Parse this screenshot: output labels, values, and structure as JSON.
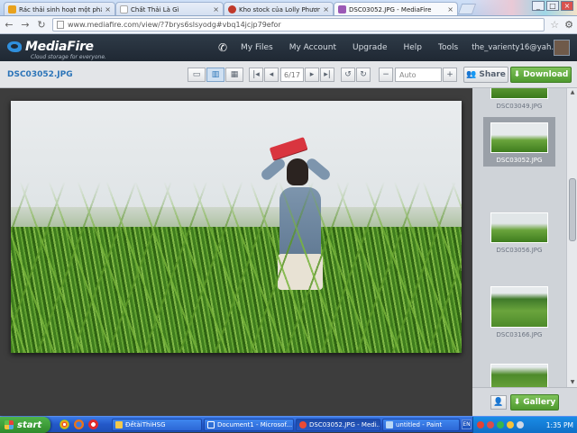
{
  "browser": {
    "tabs": [
      {
        "label": "Rác thải sinh hoạt một phần",
        "fav_color": "#e8a21e",
        "active": false
      },
      {
        "label": "Chất Thải Là Gì",
        "fav_color": "#ffffff",
        "active": false
      },
      {
        "label": "Kho stock của Lolly Phương",
        "fav_color": "#c0392b",
        "active": false
      },
      {
        "label": "DSC03052.JPG - MediaFire",
        "fav_color": "#9b59b6",
        "active": true
      }
    ],
    "url": "www.mediafire.com/view/?7brys6slsyodg#vbq14jcjp79efor",
    "close_glyph": "×"
  },
  "mediafire": {
    "brand": "MediaFire",
    "tagline": "Cloud storage for everyone.",
    "nav": [
      "My Files",
      "My Account",
      "Upgrade",
      "Help",
      "Tools"
    ],
    "user": "the_varienty16@yah..."
  },
  "viewer": {
    "filename": "DSC03052.JPG",
    "page_indicator": "6/17",
    "zoom_placeholder": "Auto",
    "share_label": "Share",
    "download_label": "Download",
    "gallery_label": "Gallery",
    "thumbnails": [
      {
        "label": "DSC03049.JPG",
        "selected": false
      },
      {
        "label": "DSC03052.JPG",
        "selected": true
      },
      {
        "label": "DSC03056.JPG",
        "selected": false
      },
      {
        "label": "DSC03166.JPG",
        "selected": false
      }
    ]
  },
  "taskbar": {
    "start_label": "start",
    "tasks": [
      {
        "label": "ĐềtàiThiHSG",
        "icon_color": "#f2c94c"
      },
      {
        "label": "Document1 - Microsof...",
        "icon_color": "#2f6fd6"
      },
      {
        "label": "DSC03052.JPG - Medi...",
        "icon_color": "#e94b35",
        "active": true
      },
      {
        "label": "untitled - Paint",
        "icon_color": "#b9d8f6"
      }
    ],
    "lang": "EN",
    "clock": "1:35 PM"
  }
}
